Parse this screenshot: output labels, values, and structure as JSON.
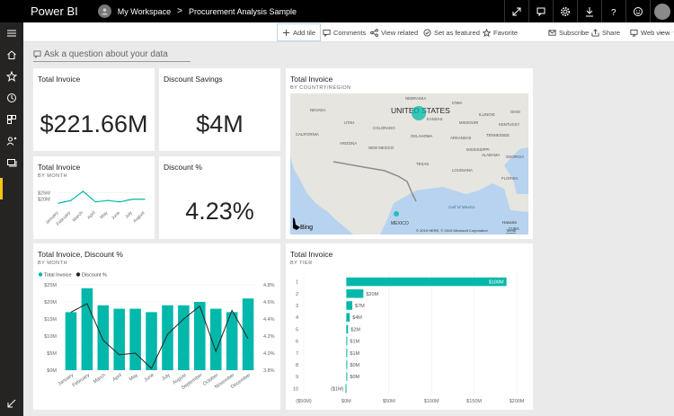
{
  "topbar": {
    "app_title": "Power BI",
    "workspace": "My Workspace",
    "separator": ">",
    "report": "Procurement Analysis Sample",
    "icons": [
      "fullscreen-icon",
      "notifications-icon",
      "settings-icon",
      "download-icon",
      "help-icon",
      "feedback-icon",
      "user-avatar"
    ]
  },
  "actionbar": {
    "add_tile": "Add tile",
    "comments": "Comments",
    "view_related": "View related",
    "set_as_featured": "Set as featured",
    "favorite": "Favorite",
    "subscribe": "Subscribe",
    "share": "Share",
    "web_view": "Web view",
    "more": "···"
  },
  "qna": {
    "placeholder": "Ask a question about your data"
  },
  "tiles": {
    "total_invoice": {
      "title": "Total Invoice",
      "value": "$221.66M"
    },
    "discount_savings": {
      "title": "Discount Savings",
      "value": "$4M"
    },
    "discount_pct": {
      "title": "Discount %",
      "value": "4.23%"
    },
    "map": {
      "title": "Total Invoice",
      "subtitle": "BY COUNTRY/REGION",
      "country_label": "UNITED STATES",
      "mexico_label": "MEXICO",
      "gulf_label": "Gulf of Mexico",
      "havana": "Havana",
      "cuba": "CUBA",
      "bing": "Bing",
      "copyright": "© 2019 HERE, © 2019 Microsoft Corporation",
      "terms": "Terms",
      "states": [
        "NEBRASKA",
        "IOWA",
        "NEVADA",
        "KANSAS",
        "ILLINOIS",
        "OHIO",
        "MISSOURI",
        "KENTUCKY",
        "CALIFORNIA",
        "UTAH",
        "COLORADO",
        "OKLAHOMA",
        "ARKANSAS",
        "TENNESSEE",
        "ARIZONA",
        "NEW MEXICO",
        "MISSISSIPPI",
        "ALABAMA",
        "GEORGIA",
        "TEXAS",
        "LOUISIANA",
        "FLORIDA"
      ]
    }
  },
  "chart_data": [
    {
      "type": "line",
      "title": "Total Invoice",
      "subtitle": "BY MONTH",
      "categories": [
        "January",
        "February",
        "March",
        "April",
        "May",
        "June",
        "July",
        "August"
      ],
      "values": [
        17,
        19,
        26,
        18,
        19,
        18,
        20,
        20
      ],
      "yticks": [
        "$25M",
        "$20M"
      ],
      "ylim": [
        13,
        28
      ],
      "color": "#01b8aa"
    },
    {
      "type": "bar",
      "title": "Total Invoice, Discount %",
      "subtitle": "BY MONTH",
      "legend": [
        "Total Invoice",
        "Discount %"
      ],
      "categories": [
        "January",
        "February",
        "March",
        "April",
        "May",
        "June",
        "July",
        "August",
        "September",
        "October",
        "November",
        "December"
      ],
      "series": [
        {
          "name": "Total Invoice",
          "values": [
            17,
            24,
            19,
            18,
            18,
            17,
            19,
            19,
            20,
            18,
            17,
            21
          ],
          "color": "#01b8aa"
        },
        {
          "name": "Discount %",
          "values": [
            4.48,
            4.58,
            4.15,
            3.98,
            4.0,
            3.82,
            4.22,
            4.4,
            4.55,
            4.02,
            4.5,
            4.17
          ],
          "color": "#252423"
        }
      ],
      "yticks_left": [
        "$25M",
        "$20M",
        "$15M",
        "$10M",
        "$5M",
        "$0M"
      ],
      "yticks_right": [
        "4.8%",
        "4.6%",
        "4.4%",
        "4.2%",
        "4.0%",
        "3.8%"
      ],
      "ylim": [
        0,
        25
      ],
      "ylim_right": [
        3.8,
        4.8
      ]
    },
    {
      "type": "bar",
      "orientation": "horizontal",
      "title": "Total Invoice",
      "subtitle": "BY TIER",
      "categories": [
        "1",
        "2",
        "3",
        "4",
        "5",
        "6",
        "7",
        "8",
        "9",
        "10"
      ],
      "values": [
        188,
        20,
        7,
        4,
        2,
        1,
        1,
        0,
        0,
        -1
      ],
      "labels": [
        "$188M",
        "$20M",
        "$7M",
        "$4M",
        "$2M",
        "$1M",
        "$1M",
        "$0M",
        "$0M",
        "($1M)"
      ],
      "xticks": [
        "($50M)",
        "$0M",
        "$50M",
        "$100M",
        "$150M",
        "$200M"
      ],
      "xlim": [
        -50,
        200
      ],
      "color": "#01b8aa"
    }
  ]
}
